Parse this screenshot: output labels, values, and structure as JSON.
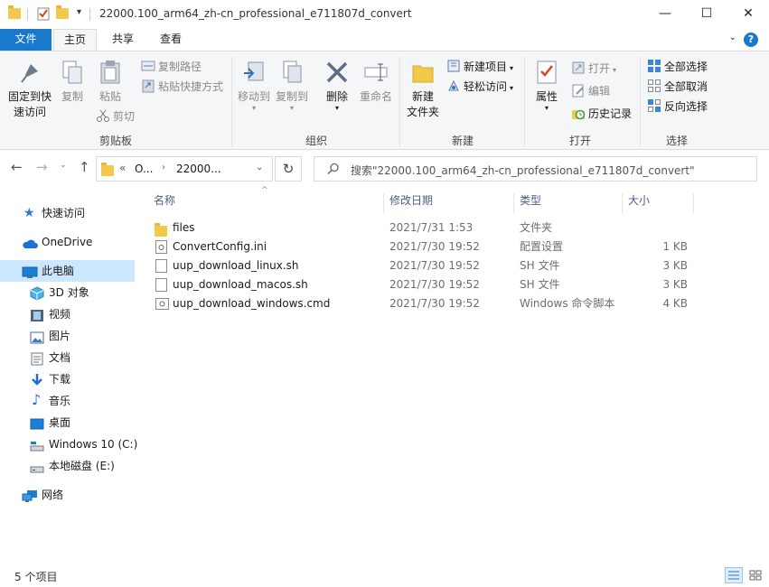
{
  "window": {
    "title": "22000.100_arm64_zh-cn_professional_e711807d_convert",
    "minimize": "—",
    "maximize": "☐",
    "close": "✕"
  },
  "tabs": [
    {
      "label": "文件"
    },
    {
      "label": "主页"
    },
    {
      "label": "共享"
    },
    {
      "label": "查看"
    }
  ],
  "ribbon": {
    "clipboard": {
      "label": "剪贴板",
      "pin": "固定到快\n速访问",
      "copy": "复制",
      "paste": "粘贴",
      "copy_path": "复制路径",
      "paste_shortcut": "粘贴快捷方式",
      "cut": "剪切"
    },
    "organize": {
      "label": "组织",
      "move_to": "移动到",
      "copy_to": "复制到",
      "delete": "删除",
      "rename": "重命名"
    },
    "new": {
      "label": "新建",
      "new_folder": "新建\n文件夹",
      "new_item": "新建项目",
      "easy_access": "轻松访问"
    },
    "open": {
      "label": "打开",
      "properties": "属性",
      "open": "打开",
      "edit": "编辑",
      "history": "历史记录"
    },
    "select": {
      "label": "选择",
      "select_all": "全部选择",
      "select_none": "全部取消",
      "invert": "反向选择"
    }
  },
  "address": {
    "seg1": "O...",
    "seg2": "22000...",
    "prefix": "«",
    "search_placeholder": "搜索\"22000.100_arm64_zh-cn_professional_e711807d_convert\""
  },
  "nav": {
    "quick_access": "快速访问",
    "onedrive": "OneDrive",
    "this_pc": "此电脑",
    "objects3d": "3D 对象",
    "videos": "视频",
    "pictures": "图片",
    "documents": "文档",
    "downloads": "下载",
    "music": "音乐",
    "desktop": "桌面",
    "win10": "Windows 10 (C:)",
    "local_disk": "本地磁盘 (E:)",
    "network": "网络"
  },
  "columns": {
    "name": "名称",
    "date": "修改日期",
    "type": "类型",
    "size": "大小"
  },
  "files": [
    {
      "name": "files",
      "date": "2021/7/31 1:53",
      "type": "文件夹",
      "size": ""
    },
    {
      "name": "ConvertConfig.ini",
      "date": "2021/7/30 19:52",
      "type": "配置设置",
      "size": "1 KB"
    },
    {
      "name": "uup_download_linux.sh",
      "date": "2021/7/30 19:52",
      "type": "SH 文件",
      "size": "3 KB"
    },
    {
      "name": "uup_download_macos.sh",
      "date": "2021/7/30 19:52",
      "type": "SH 文件",
      "size": "3 KB"
    },
    {
      "name": "uup_download_windows.cmd",
      "date": "2021/7/30 19:52",
      "type": "Windows 命令脚本",
      "size": "4 KB"
    }
  ],
  "status": {
    "count": "5 个项目"
  },
  "colors": {
    "accent": "#1979ca",
    "selected": "#cce8ff",
    "folder": "#f3c94c"
  }
}
